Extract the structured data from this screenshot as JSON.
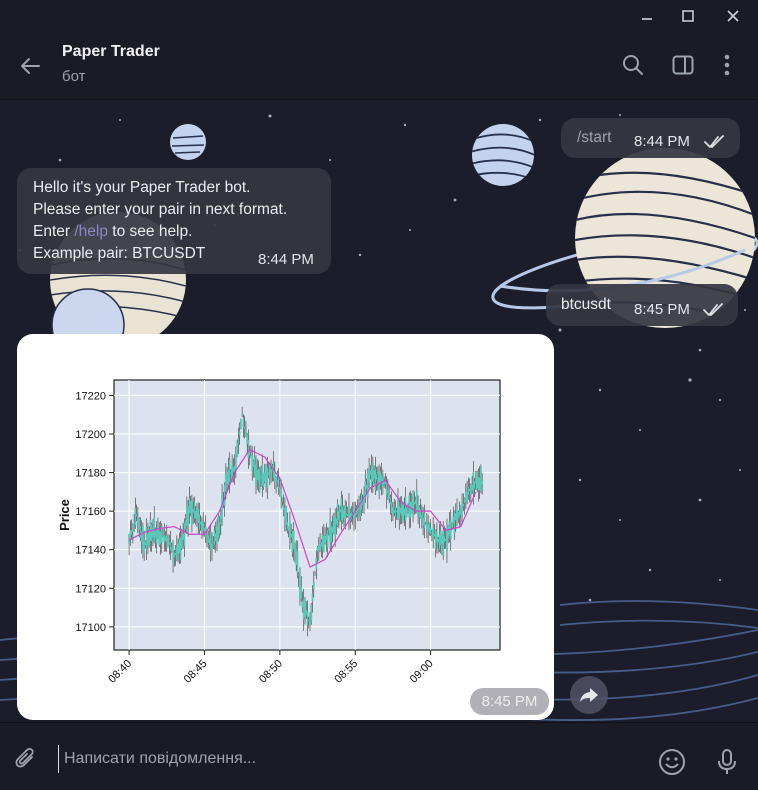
{
  "window": {
    "minimize_icon": "minimize-icon",
    "maximize_icon": "maximize-icon",
    "close_icon": "close-icon"
  },
  "header": {
    "title": "Paper Trader",
    "subtitle": "бот",
    "icons": [
      "back-arrow-icon",
      "search-icon",
      "sidebar-toggle-icon",
      "more-vertical-icon"
    ]
  },
  "messages": {
    "start": {
      "text": "/start",
      "time": "8:44 PM",
      "status_icon": "double-check-icon"
    },
    "greeting": {
      "line1": "Hello it's your Paper Trader bot.",
      "line2": "Please enter your pair in next format.",
      "line3_pre": "Enter ",
      "line3_link": "/help",
      "line3_post": " to see help.",
      "line4": "Example pair: BTCUSDT",
      "time": "8:44 PM"
    },
    "pair": {
      "text": "btcusdt",
      "time": "8:45 PM",
      "status_icon": "double-check-icon"
    },
    "chart_photo": {
      "time": "8:45 PM",
      "forward_icon": "forward-arrow-icon"
    }
  },
  "composer": {
    "placeholder": "Написати повідомлення...",
    "icons": [
      "paperclip-icon",
      "emoji-icon",
      "microphone-icon"
    ]
  },
  "colors": {
    "background": "#1c1d2a",
    "bubble": "#343642",
    "link": "#8f86c6",
    "candle": "#5ac8b8",
    "moving_average": "#cc44cc",
    "plot_bg": "#dde3ee"
  },
  "chart_data": {
    "type": "line",
    "title": "",
    "xlabel": "",
    "ylabel": "Price",
    "x_ticks": [
      "08:40",
      "08:45",
      "08:50",
      "08:55",
      "09:00"
    ],
    "y_ticks": [
      17100,
      17120,
      17140,
      17160,
      17180,
      17200,
      17220
    ],
    "ylim": [
      17088,
      17228
    ],
    "grid": true,
    "series": [
      {
        "style": "candlestick",
        "color": "#5ac8b8",
        "x_minutes": [
          0,
          0.5,
          1,
          1.5,
          2,
          2.5,
          3,
          3.5,
          4,
          4.5,
          5,
          5.5,
          6,
          6.5,
          7,
          7.5,
          8,
          8.5,
          9,
          9.5,
          10,
          10.5,
          11,
          11.5,
          12,
          12.5,
          13,
          13.5,
          14,
          14.5,
          15,
          15.5,
          16,
          16.5,
          17,
          17.5,
          18,
          18.5,
          19,
          19.5,
          20,
          20.5,
          21,
          21.5,
          22,
          22.5,
          23
        ],
        "close": [
          17145,
          17158,
          17142,
          17150,
          17147,
          17146,
          17137,
          17143,
          17162,
          17158,
          17150,
          17142,
          17152,
          17178,
          17182,
          17210,
          17190,
          17178,
          17177,
          17182,
          17172,
          17153,
          17142,
          17112,
          17102,
          17140,
          17145,
          17150,
          17160,
          17158,
          17158,
          17165,
          17180,
          17177,
          17175,
          17160,
          17160,
          17160,
          17165,
          17155,
          17150,
          17145,
          17145,
          17155,
          17160,
          17170,
          17175
        ]
      },
      {
        "style": "moving_average",
        "color": "#cc44cc",
        "x_minutes": [
          0,
          1,
          2,
          3,
          4,
          5,
          6,
          7,
          8,
          9,
          10,
          11,
          12,
          13,
          14,
          15,
          16,
          17,
          18,
          19,
          20,
          21,
          22,
          23
        ],
        "values": [
          17145,
          17149,
          17151,
          17152,
          17148,
          17148,
          17160,
          17180,
          17192,
          17188,
          17177,
          17155,
          17131,
          17135,
          17148,
          17160,
          17172,
          17176,
          17165,
          17160,
          17160,
          17150,
          17152,
          17170
        ]
      }
    ]
  }
}
